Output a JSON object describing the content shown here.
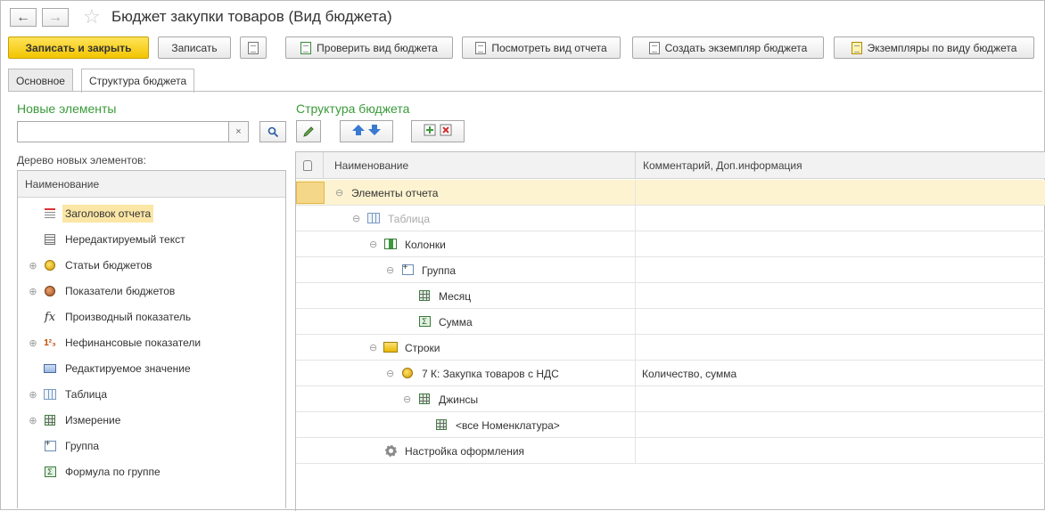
{
  "window": {
    "title": "Бюджет закупки товаров (Вид бюджета)"
  },
  "toolbar": {
    "save_close": "Записать и закрыть",
    "save": "Записать",
    "check": "Проверить вид бюджета",
    "view_report": "Посмотреть вид отчета",
    "create_instance": "Создать экземпляр бюджета",
    "instances": "Экземпляры по виду бюджета"
  },
  "tabs": [
    {
      "label": "Основное",
      "active": false
    },
    {
      "label": "Структура бюджета",
      "active": true
    }
  ],
  "left": {
    "title": "Новые элементы",
    "search_value": "",
    "tree_label": "Дерево новых элементов:",
    "column": "Наименование",
    "items": [
      {
        "label": "Заголовок отчета",
        "icon": "report-header-icon",
        "expandable": false,
        "selected": true
      },
      {
        "label": "Нередактируемый текст",
        "icon": "text-icon",
        "expandable": false
      },
      {
        "label": "Статьи бюджетов",
        "icon": "coins-icon",
        "expandable": true
      },
      {
        "label": "Показатели бюджетов",
        "icon": "coins-brown-icon",
        "expandable": true
      },
      {
        "label": "Производный показатель",
        "icon": "fx-icon",
        "expandable": false
      },
      {
        "label": "Нефинансовые показатели",
        "icon": "nonfinancial-icon",
        "expandable": true
      },
      {
        "label": "Редактируемое значение",
        "icon": "editable-value-icon",
        "expandable": false
      },
      {
        "label": "Таблица",
        "icon": "table-icon",
        "expandable": true
      },
      {
        "label": "Измерение",
        "icon": "dimension-icon",
        "expandable": true
      },
      {
        "label": "Группа",
        "icon": "group-icon",
        "expandable": false
      },
      {
        "label": "Формула по группе",
        "icon": "sum-icon",
        "expandable": false
      }
    ]
  },
  "right": {
    "title": "Структура бюджета",
    "columns": [
      "Наименование",
      "Комментарий, Доп.информация"
    ],
    "rows": [
      {
        "label": "Элементы отчета",
        "icon": "",
        "comment": "",
        "expander": "⊖",
        "selected": true,
        "muted": false
      },
      {
        "label": "Таблица",
        "icon": "table-icon",
        "comment": "",
        "expander": "⊖",
        "muted": true
      },
      {
        "label": "Колонки",
        "icon": "columns-icon",
        "comment": "",
        "expander": "⊖"
      },
      {
        "label": "Группа",
        "icon": "group-icon",
        "comment": "",
        "expander": "⊖"
      },
      {
        "label": "Месяц",
        "icon": "dimension-icon",
        "comment": "",
        "expander": ""
      },
      {
        "label": "Сумма",
        "icon": "sum-icon",
        "comment": "",
        "expander": ""
      },
      {
        "label": "Строки",
        "icon": "rows-icon",
        "comment": "",
        "expander": "⊖"
      },
      {
        "label": "7 К: Закупка товаров с НДС",
        "icon": "coins-icon",
        "comment": "Количество, сумма",
        "expander": "⊖"
      },
      {
        "label": "Джинсы",
        "icon": "dimension-icon",
        "comment": "",
        "expander": "⊖"
      },
      {
        "label": "<все Номенклатура>",
        "icon": "dimension-icon",
        "comment": "",
        "expander": ""
      },
      {
        "label": "Настройка оформления",
        "icon": "gear-icon",
        "comment": "",
        "expander": ""
      }
    ]
  }
}
